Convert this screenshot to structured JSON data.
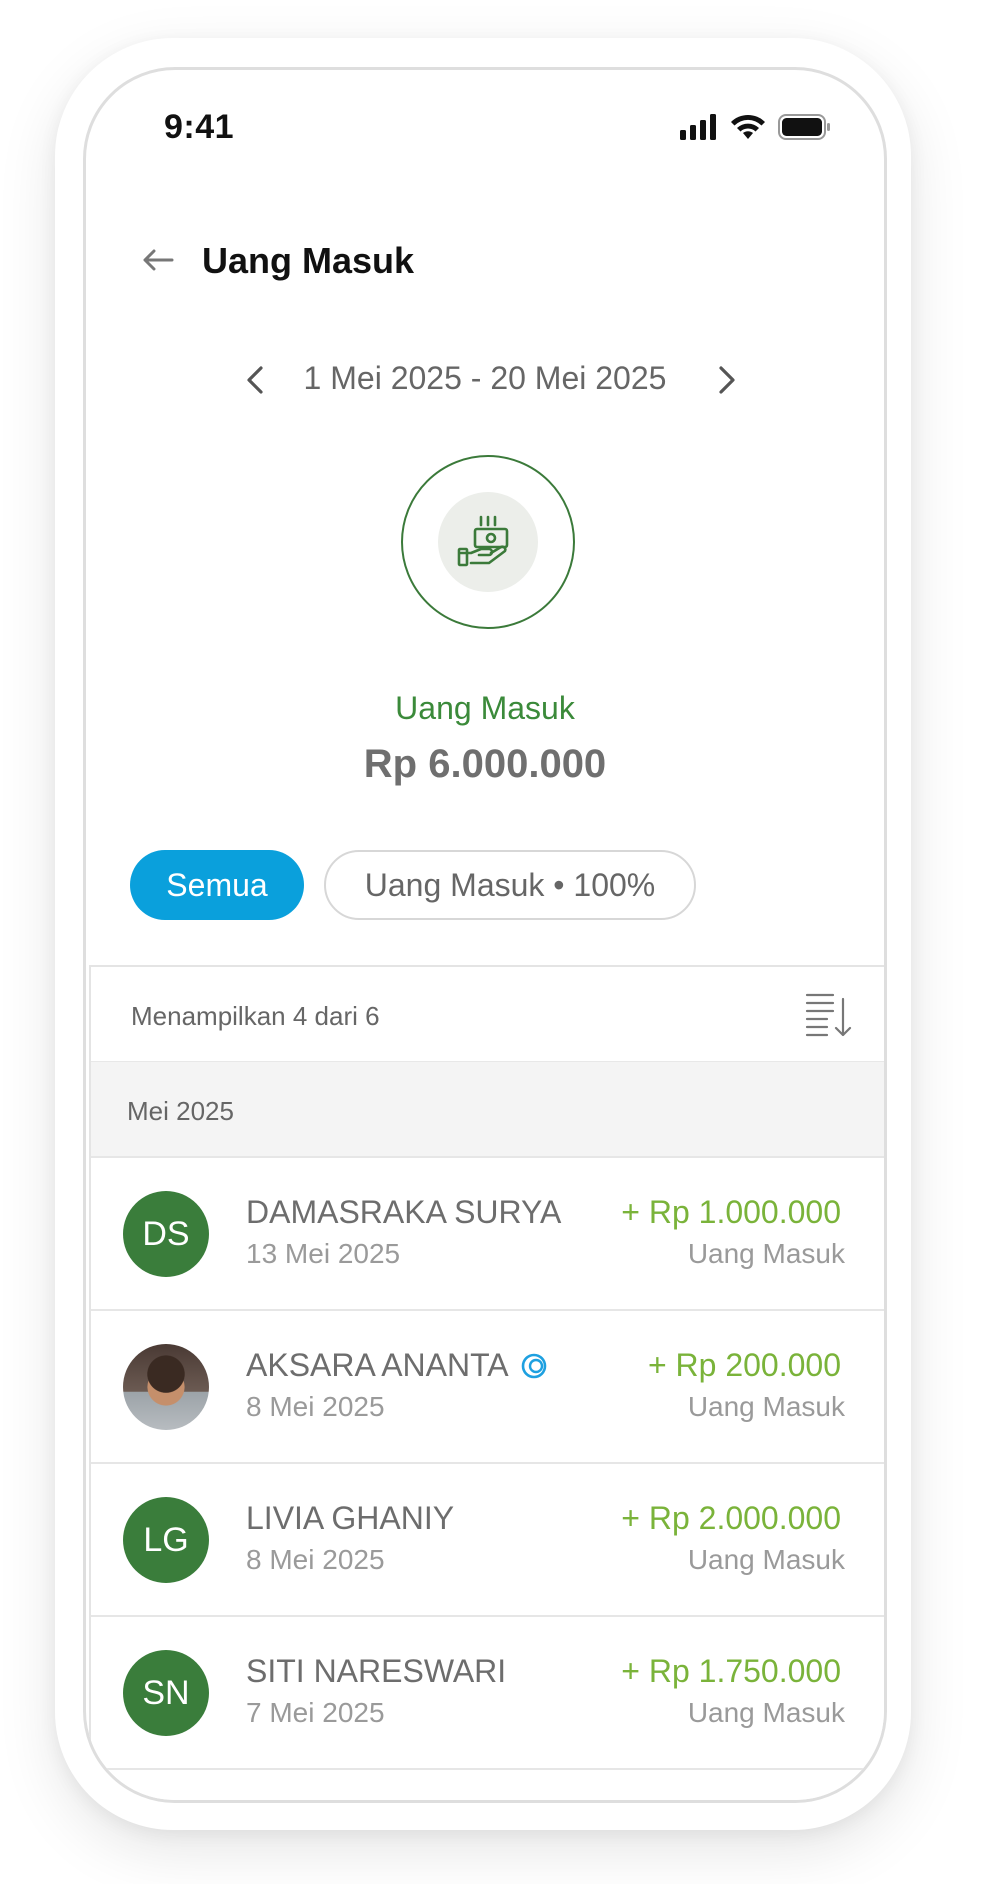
{
  "status_bar": {
    "time": "9:41"
  },
  "header": {
    "title": "Uang Masuk"
  },
  "period": {
    "label": "1 Mei 2025 - 20 Mei 2025"
  },
  "summary": {
    "label": "Uang Masuk",
    "amount": "Rp 6.000.000"
  },
  "filters": [
    {
      "label": "Semua",
      "active": true
    },
    {
      "label": "Uang Masuk • 100%",
      "active": false
    }
  ],
  "list": {
    "count_text": "Menampilkan 4 dari 6",
    "section_title": "Mei 2025",
    "items": [
      {
        "initials": "DS",
        "name": "DAMASRAKA SURYA",
        "date": "13 Mei 2025",
        "amount": "+ Rp 1.000.000",
        "type": "Uang Masuk"
      },
      {
        "initials": "",
        "name": "AKSARA ANANTA",
        "date": "8 Mei 2025",
        "amount": "+ Rp 200.000",
        "type": "Uang Masuk"
      },
      {
        "initials": "LG",
        "name": "LIVIA GHANIY",
        "date": "8 Mei 2025",
        "amount": "+ Rp 2.000.000",
        "type": "Uang Masuk"
      },
      {
        "initials": "SN",
        "name": "SITI NARESWARI",
        "date": "7 Mei 2025",
        "amount": "+ Rp 1.750.000",
        "type": "Uang Masuk"
      }
    ]
  },
  "colors": {
    "accent": "#0aa0dc",
    "green": "#3a7d3b",
    "amount_green": "#7ab33a"
  }
}
